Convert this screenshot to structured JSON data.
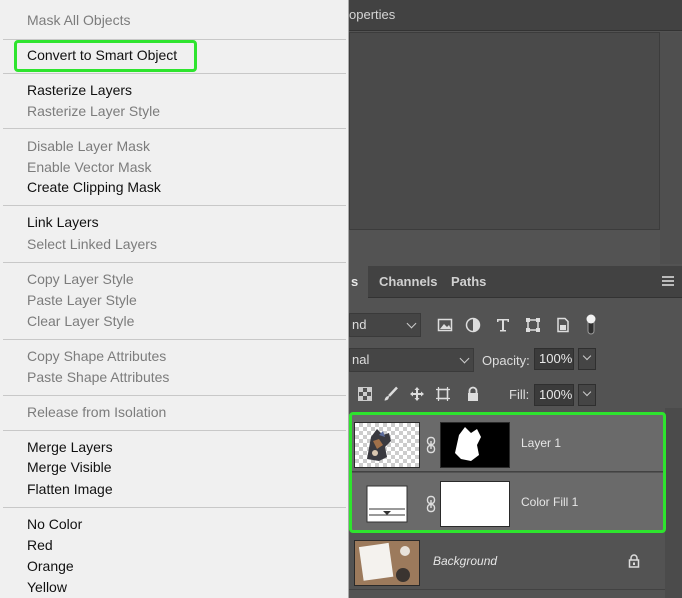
{
  "properties_panel": {
    "title": "operties"
  },
  "layers_panel": {
    "tabs": [
      {
        "label": "s",
        "active": true
      },
      {
        "label": "Channels",
        "active": false
      },
      {
        "label": "Paths",
        "active": false
      }
    ],
    "filter_kind": {
      "value": "nd"
    },
    "filter_icons": [
      "image-filter-icon",
      "adjustment-filter-icon",
      "type-filter-icon",
      "shape-filter-icon",
      "smart-object-filter-icon",
      "filter-toggle-icon"
    ],
    "blend_mode": {
      "value": "nal"
    },
    "opacity": {
      "label": "Opacity:",
      "value": "100%"
    },
    "lock_icons": [
      "lock-transparent-icon",
      "lock-image-icon",
      "lock-position-icon",
      "lock-artboard-icon",
      "lock-all-icon"
    ],
    "fill": {
      "label": "Fill:",
      "value": "100%"
    },
    "layers": [
      {
        "name": "Layer 1",
        "selected": true,
        "has_mask": true
      },
      {
        "name": "Color Fill 1",
        "selected": true,
        "has_mask": true
      },
      {
        "name": "Background",
        "selected": false,
        "locked": true
      }
    ]
  },
  "context_menu": {
    "groups": [
      [
        {
          "label": "Mask All Objects",
          "enabled": false
        }
      ],
      [
        {
          "label": "Convert to Smart Object",
          "enabled": true,
          "highlighted": true
        }
      ],
      [
        {
          "label": "Rasterize Layers",
          "enabled": true
        },
        {
          "label": "Rasterize Layer Style",
          "enabled": false
        }
      ],
      [
        {
          "label": "Disable Layer Mask",
          "enabled": false
        },
        {
          "label": "Enable Vector Mask",
          "enabled": false
        },
        {
          "label": "Create Clipping Mask",
          "enabled": true
        }
      ],
      [
        {
          "label": "Link Layers",
          "enabled": true
        },
        {
          "label": "Select Linked Layers",
          "enabled": false
        }
      ],
      [
        {
          "label": "Copy Layer Style",
          "enabled": false
        },
        {
          "label": "Paste Layer Style",
          "enabled": false
        },
        {
          "label": "Clear Layer Style",
          "enabled": false
        }
      ],
      [
        {
          "label": "Copy Shape Attributes",
          "enabled": false
        },
        {
          "label": "Paste Shape Attributes",
          "enabled": false
        }
      ],
      [
        {
          "label": "Release from Isolation",
          "enabled": false
        }
      ],
      [
        {
          "label": "Merge Layers",
          "enabled": true
        },
        {
          "label": "Merge Visible",
          "enabled": true
        },
        {
          "label": "Flatten Image",
          "enabled": true
        }
      ],
      [
        {
          "label": "No Color",
          "enabled": true
        },
        {
          "label": "Red",
          "enabled": true
        },
        {
          "label": "Orange",
          "enabled": true
        },
        {
          "label": "Yellow",
          "enabled": true
        }
      ]
    ]
  },
  "colors": {
    "highlight": "#2ee42e",
    "panel_bg": "#535353",
    "menu_bg": "#f0f0f0",
    "selected_layer": "#6a6a6a"
  }
}
